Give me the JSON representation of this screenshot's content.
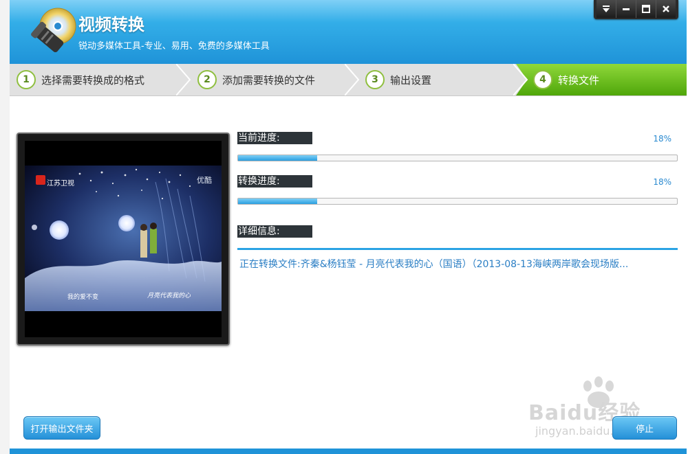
{
  "app": {
    "title": "视频转换",
    "subtitle": "锐动多媒体工具-专业、易用、免费的多媒体工具"
  },
  "window_controls": [
    {
      "icon": "dropdown-icon"
    },
    {
      "icon": "minimize-icon"
    },
    {
      "icon": "maximize-icon"
    },
    {
      "icon": "close-icon"
    }
  ],
  "steps": [
    {
      "number": "1",
      "label": "选择需要转换成的格式",
      "active": false
    },
    {
      "number": "2",
      "label": "添加需要转换的文件",
      "active": false
    },
    {
      "number": "3",
      "label": "输出设置",
      "active": false
    },
    {
      "number": "4",
      "label": "转换文件",
      "active": true
    }
  ],
  "progress": {
    "current_label": "当前进度:",
    "current_percent": "18%",
    "current_value": 0.18,
    "convert_label": "转换进度:",
    "convert_percent": "18%",
    "convert_value": 0.18
  },
  "detail": {
    "label": "详细信息:",
    "text": "正在转换文件:齐秦&杨钰莹 - 月亮代表我的心（国语）（2013-08-13海峡两岸歌会现场版..."
  },
  "preview": {
    "channel_logo": "江苏卫视",
    "source_logo": "优酷",
    "subtitle_left": "我的爱不变",
    "subtitle_right": "月亮代表我的心"
  },
  "buttons": {
    "open_output_folder": "打开输出文件夹",
    "stop": "停止"
  },
  "watermark": {
    "brand": "Baidu经验",
    "url": "jingyan.baidu.com"
  },
  "colors": {
    "header_blue": "#1f93d8",
    "active_step_green": "#6cc010",
    "progress_blue": "#2a9ee0",
    "detail_text_blue": "#2a7ec4"
  }
}
